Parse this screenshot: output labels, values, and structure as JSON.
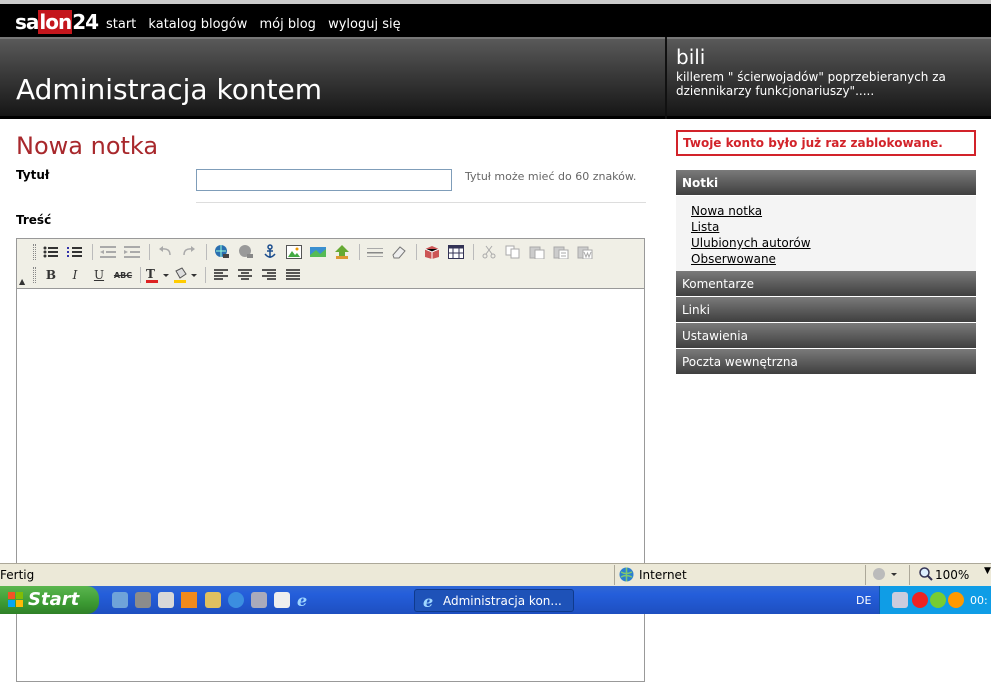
{
  "topnav": {
    "logo": {
      "pre": "sa",
      "mid": "lon",
      "post": "24"
    },
    "links": [
      "start",
      "katalog blogów",
      "mój blog",
      "wyloguj się"
    ]
  },
  "header": {
    "page_title": "Administracja kontem",
    "blog_name": "bili",
    "blog_description": "killerem \" ścierwojadów\" poprzebieranych za dziennikarzy funkcjonariuszy\"....."
  },
  "form": {
    "heading": "Nowa notka",
    "title_label": "Tytuł",
    "title_value": "",
    "title_hint": "Tytuł może mieć do 60 znaków.",
    "content_label": "Treść",
    "toolbar": {
      "bold": "B",
      "italic": "I",
      "underline": "U",
      "strike": "ABC"
    }
  },
  "sidebar": {
    "blocked_notice": "Twoje konto było już raz zablokowane.",
    "notki": {
      "label": "Notki",
      "items": [
        "Nowa notka",
        "Lista",
        "Ulubionych autorów",
        "Obserwowane"
      ]
    },
    "sections": [
      "Komentarze",
      "Linki",
      "Ustawienia",
      "Poczta wewnętrzna"
    ]
  },
  "statusbar": {
    "status": "Fertig",
    "zone": "Internet",
    "zoom": "100%"
  },
  "taskbar": {
    "start_label": "Start",
    "task_label": "Administracja kon...",
    "lang": "DE",
    "clock": "00:"
  },
  "colors": {
    "accent_red": "#a8282c",
    "notice_red": "#d2232a"
  }
}
